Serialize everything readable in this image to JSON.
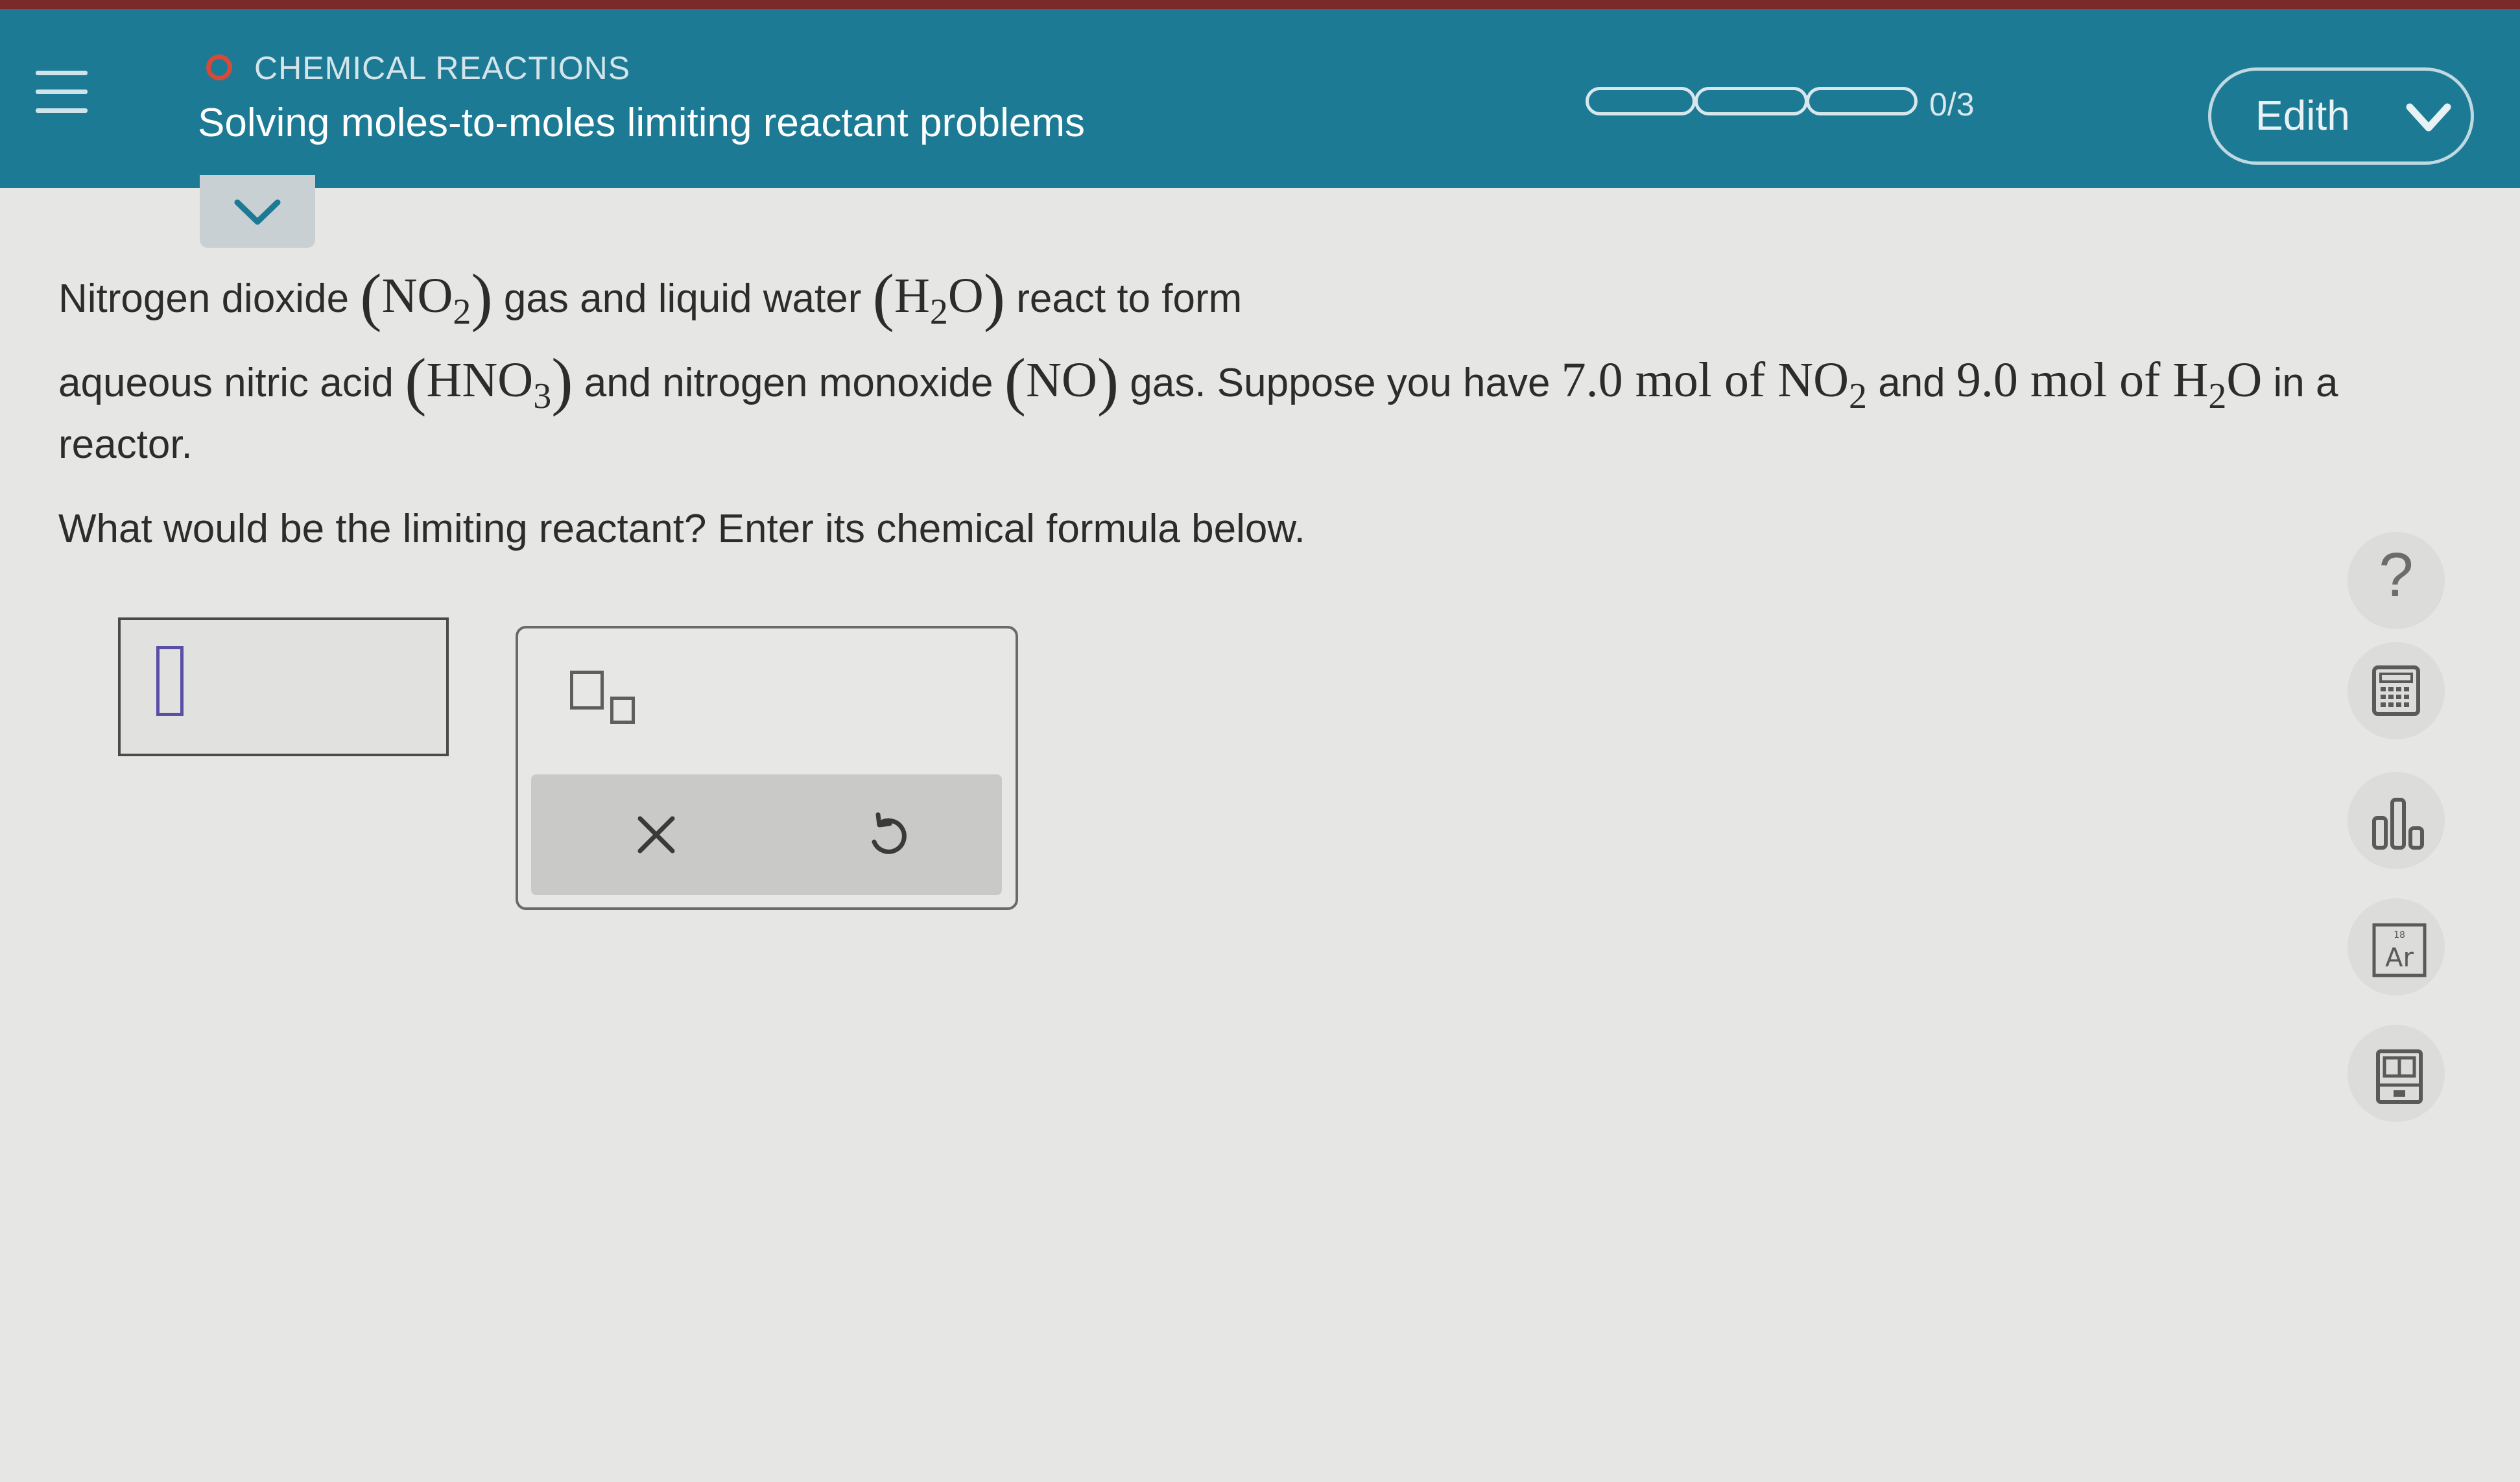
{
  "header": {
    "topic": "CHEMICAL REACTIONS",
    "title": "Solving moles-to-moles limiting reactant problems",
    "progress_label": "0/3",
    "progress": {
      "completed": 0,
      "total": 3
    },
    "user_name": "Edith",
    "colors": {
      "bar": "#1d7a95",
      "topic_dot": "#d64a3a"
    }
  },
  "question": {
    "l1_a": "Nitrogen dioxide",
    "l1_f1": "NO",
    "l1_f1_sub": "2",
    "l1_b": "gas  and liquid water",
    "l1_f2_a": "H",
    "l1_f2_sub": "2",
    "l1_f2_b": "O",
    "l1_c": "react to form",
    "l2_a": "aqueous nitric acid",
    "l2_f1": "HNO",
    "l2_f1_sub": "3",
    "l2_b": "and nitrogen monoxide",
    "l2_f2": "NO",
    "l2_c": "gas. Suppose you have",
    "l2_q1": "7.0 mol of NO",
    "l2_q1_sub": "2",
    "l2_d": "and",
    "l2_q2_a": "9.0 mol of H",
    "l2_q2_sub": "2",
    "l2_q2_b": "O",
    "l2_e": "in a",
    "l3": "reactor.",
    "prompt": "What would be the limiting reactant? Enter its chemical formula below."
  },
  "answer": {
    "value": ""
  },
  "side_tools": {
    "help": "?",
    "icons": [
      "calculator-icon",
      "chart-icon",
      "periodic-table-icon",
      "reference-book-icon"
    ]
  }
}
